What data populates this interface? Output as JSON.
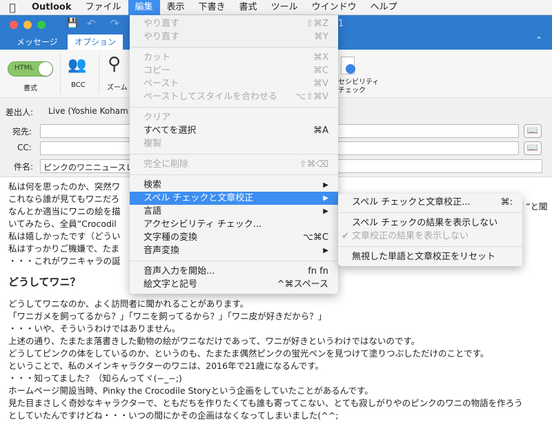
{
  "menubar": {
    "app": "Outlook",
    "items": [
      "ファイル",
      "編集",
      "表示",
      "下書き",
      "書式",
      "ツール",
      "ウインドウ",
      "ヘルプ"
    ]
  },
  "window": {
    "title_fragment": "1",
    "tabs": [
      "メッセージ",
      "オプション"
    ]
  },
  "ribbon": {
    "html_toggle": "HTML",
    "format_label": "書式",
    "bcc_label": "BCC",
    "zoom_label": "ズーム",
    "accessibility_label_1": "セシビリティ",
    "accessibility_label_2": "チェック"
  },
  "header": {
    "from_label": "差出人:",
    "from_value": "Live (Yoshie Koham",
    "to_label": "宛先:",
    "cc_label": "CC:",
    "subject_label": "件名:",
    "subject_value": "ピンクのワニニュースレ"
  },
  "body": {
    "top_lines": [
      "私は何を思ったのか、突然ワ",
      "これなら誰が見てもワニだろ",
      "なんとか適当にワニの絵を描",
      "いてみたら、全員”Crocodil",
      "私は嬉しかったです（どうい",
      "私はすっかりご機嫌で、たま",
      "・・・これがワニキャラの誕"
    ],
    "right_fragment": "”と聞",
    "heading": "どうしてワニ？",
    "lines": [
      "どうしてワニなのか、よく訪問者に聞かれることがあります。",
      "「ワニガメを飼ってるから？」「ワニを飼ってるから？」「ワニ皮が好きだから？」",
      "・・・いや、そういうわけではありません。",
      "上述の通り、たまたま落書きした動物の絵がワニなだけであって、ワニが好きというわけではないのです。",
      "どうしてピンクの体をしているのか、というのも、たまたま偶然ピンクの蛍光ペンを見つけて塗りつぶしただけのことです。",
      "ということで、私のメインキャラクターのワニは、2016年で21歳になるんです。",
      "・・・知ってました？（知らんってヾ(−_−;)",
      "ホームページ開設当時、Pinky the Crocodile Storyという企画をしていたことがあるんです。",
      "見た目まさしく奇妙なキャラクターで、ともだちを作りたくても誰も寄ってこない、とても寂しがりやのピンクのワニの物語を作ろう",
      "としていたんですけどね・・・いつの間にかその企画はなくなってしまいました(^^;"
    ]
  },
  "edit_menu": [
    [
      {
        "label": "やり直す",
        "shortcut": "⇧⌘Z",
        "disabled": true
      },
      {
        "label": "やり直す",
        "shortcut": "⌘Y",
        "disabled": true
      }
    ],
    [
      {
        "label": "カット",
        "shortcut": "⌘X",
        "disabled": true
      },
      {
        "label": "コピー",
        "shortcut": "⌘C",
        "disabled": true
      },
      {
        "label": "ペースト",
        "shortcut": "⌘V",
        "disabled": true
      },
      {
        "label": "ペーストしてスタイルを合わせる",
        "shortcut": "⌥⇧⌘V",
        "disabled": true
      }
    ],
    [
      {
        "label": "クリア",
        "shortcut": "",
        "disabled": true
      },
      {
        "label": "すべてを選択",
        "shortcut": "⌘A",
        "disabled": false
      },
      {
        "label": "複製",
        "shortcut": "",
        "disabled": true
      }
    ],
    [
      {
        "label": "完全に削除",
        "shortcut": "⇧⌘⌫",
        "disabled": true
      }
    ],
    [
      {
        "label": "検索",
        "shortcut": "▶",
        "disabled": false
      },
      {
        "label": "スペル チェックと文章校正",
        "shortcut": "▶",
        "disabled": false,
        "highlighted": true
      },
      {
        "label": "言語",
        "shortcut": "▶",
        "disabled": false
      },
      {
        "label": "アクセシビリティ チェック...",
        "shortcut": "",
        "disabled": false
      },
      {
        "label": "文字種の変換",
        "shortcut": "⌥⌘C",
        "disabled": false
      },
      {
        "label": "音声変換",
        "shortcut": "▶",
        "disabled": false
      }
    ],
    [
      {
        "label": "音声入力を開始...",
        "shortcut": "fn fn",
        "disabled": false
      },
      {
        "label": "絵文字と記号",
        "shortcut": "^⌘スペース",
        "disabled": false
      }
    ]
  ],
  "submenu": [
    [
      {
        "label": "スペル チェックと文章校正...",
        "shortcut": "⌘:",
        "disabled": false
      }
    ],
    [
      {
        "label": "スペル チェックの結果を表示しない",
        "shortcut": "",
        "disabled": false
      },
      {
        "label": "文章校正の結果を表示しない",
        "shortcut": "",
        "disabled": true,
        "checked": "✔"
      }
    ],
    [
      {
        "label": "無視した単語と文章校正をリセット",
        "shortcut": "",
        "disabled": false
      }
    ]
  ],
  "colors": {
    "accent": "#3d8ef0",
    "window_blue": "#2e7bcf"
  }
}
